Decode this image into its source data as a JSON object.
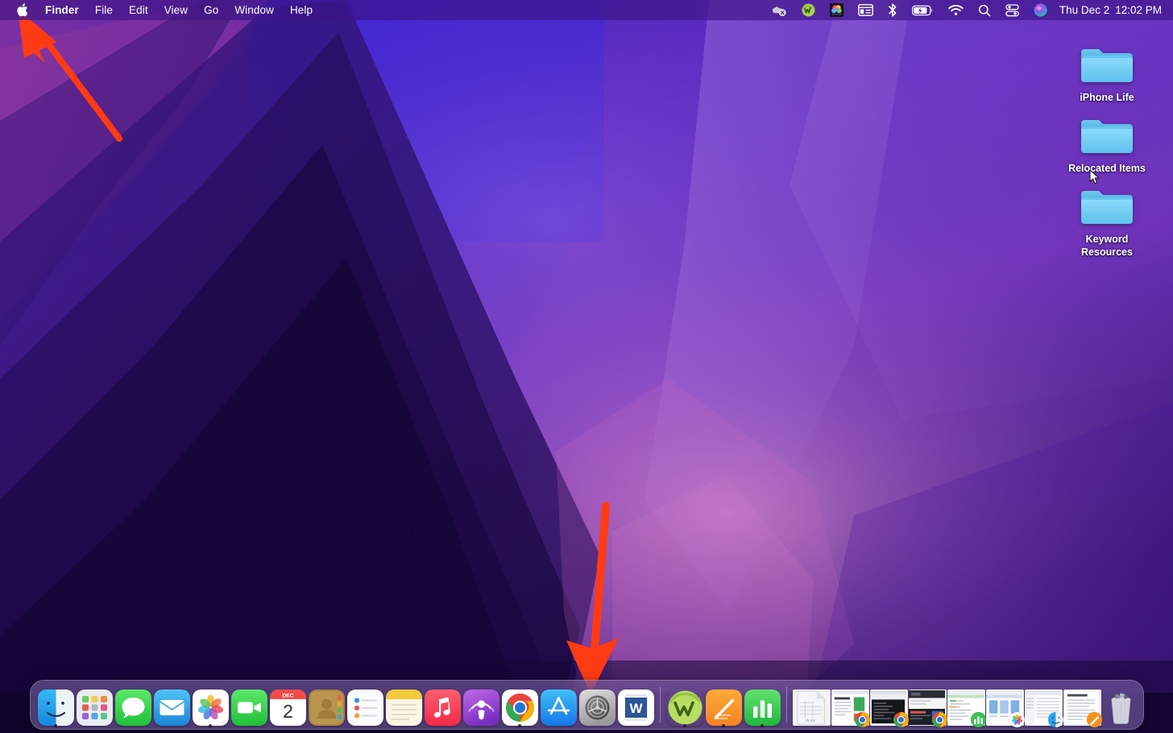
{
  "menubar": {
    "apple_icon": "apple-logo-icon",
    "items": [
      {
        "label": "Finder",
        "bold": true
      },
      {
        "label": "File",
        "bold": false
      },
      {
        "label": "Edit",
        "bold": false
      },
      {
        "label": "View",
        "bold": false
      },
      {
        "label": "Go",
        "bold": false
      },
      {
        "label": "Window",
        "bold": false
      },
      {
        "label": "Help",
        "bold": false
      }
    ],
    "status_icons": [
      {
        "name": "dropbox-offline-icon",
        "title": "Dropbox"
      },
      {
        "name": "wordtune-icon",
        "title": "Wordtune"
      },
      {
        "name": "colorsync-icon",
        "title": "Image App"
      },
      {
        "name": "display-window-icon",
        "title": "Display"
      },
      {
        "name": "bluetooth-icon",
        "title": "Bluetooth"
      },
      {
        "name": "battery-charging-icon",
        "title": "Battery"
      },
      {
        "name": "wifi-icon",
        "title": "Wi-Fi"
      },
      {
        "name": "spotlight-search-icon",
        "title": "Spotlight Search"
      },
      {
        "name": "control-center-icon",
        "title": "Control Center"
      },
      {
        "name": "siri-icon",
        "title": "Siri"
      }
    ],
    "clock": {
      "date": "Thu Dec 2",
      "time": "12:02 PM"
    }
  },
  "desktop": {
    "icons": [
      {
        "label": "iPhone Life",
        "type": "folder"
      },
      {
        "label": "Relocated Items",
        "type": "folder"
      },
      {
        "label": "Keyword Resources",
        "type": "folder"
      }
    ]
  },
  "annotations": {
    "arrows": [
      {
        "name": "arrow-to-apple-menu",
        "target": "apple-menu",
        "color": "#FF3B14"
      },
      {
        "name": "arrow-to-system-preferences",
        "target": "system-preferences-dock-icon",
        "color": "#FF3B14"
      }
    ],
    "accent_color": "#FF3B14"
  },
  "dock": {
    "apps": [
      {
        "label": "Finder",
        "icon": "finder-icon",
        "running": true
      },
      {
        "label": "Launchpad",
        "icon": "launchpad-icon",
        "running": false
      },
      {
        "label": "Messages",
        "icon": "messages-icon",
        "running": false
      },
      {
        "label": "Mail",
        "icon": "mail-icon",
        "running": false
      },
      {
        "label": "Photos",
        "icon": "photos-icon",
        "running": true
      },
      {
        "label": "FaceTime",
        "icon": "facetime-icon",
        "running": false
      },
      {
        "label": "Calendar",
        "icon": "calendar-icon",
        "running": false,
        "badge_month": "DEC",
        "badge_day": "2"
      },
      {
        "label": "Contacts",
        "icon": "contacts-icon",
        "running": false
      },
      {
        "label": "Reminders",
        "icon": "reminders-icon",
        "running": false
      },
      {
        "label": "Notes",
        "icon": "notes-icon",
        "running": false
      },
      {
        "label": "Music",
        "icon": "music-icon",
        "running": false
      },
      {
        "label": "Podcasts",
        "icon": "podcasts-icon",
        "running": false
      },
      {
        "label": "Google Chrome",
        "icon": "chrome-icon",
        "running": true
      },
      {
        "label": "App Store",
        "icon": "app-store-icon",
        "running": false
      },
      {
        "label": "System Preferences",
        "icon": "system-preferences-icon",
        "running": false
      },
      {
        "label": "Microsoft Word",
        "icon": "microsoft-word-icon",
        "running": false
      }
    ],
    "recent_apps": [
      {
        "label": "Wordtune",
        "icon": "wordtune-app-icon",
        "running": true
      },
      {
        "label": "TextEdit",
        "icon": "textedit-icon",
        "running": true
      },
      {
        "label": "Numbers",
        "icon": "numbers-icon",
        "running": true
      }
    ],
    "minimized": [
      {
        "label": "Spreadsheet.xlsx",
        "badge": "xlsx-file-icon",
        "thumb": "xlsx-document"
      },
      {
        "label": "Chrome Window",
        "badge": "chrome-icon",
        "thumb": "webpage-article"
      },
      {
        "label": "Chrome Window",
        "badge": "chrome-icon",
        "thumb": "webpage-dark"
      },
      {
        "label": "Chrome Window",
        "badge": "chrome-icon",
        "thumb": "webpage-editor"
      },
      {
        "label": "Numbers Window",
        "badge": "numbers-icon",
        "thumb": "spreadsheet-green"
      },
      {
        "label": "Photos Window",
        "badge": "photos-icon",
        "thumb": "photos-grid"
      },
      {
        "label": "Finder Window",
        "badge": "finder-icon",
        "thumb": "finder-list"
      },
      {
        "label": "TextEdit Document",
        "badge": "textedit-icon",
        "thumb": "text-document"
      }
    ],
    "trash": {
      "label": "Trash",
      "icon": "trash-full-icon"
    }
  }
}
